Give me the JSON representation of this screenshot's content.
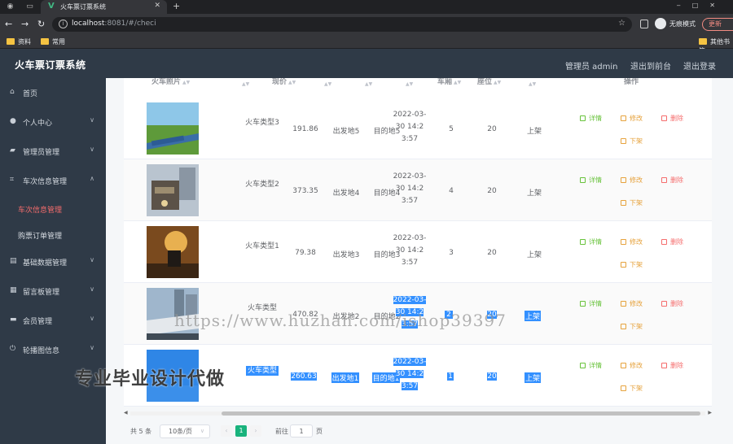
{
  "browser": {
    "tab_title": "火车票订票系统",
    "url_host": "localhost",
    "url_rest": ":8081/#/checi",
    "incognito_label": "无痕模式",
    "update_label": "更新",
    "bookmarks": [
      "资料",
      "常用",
      "其他书签"
    ]
  },
  "header": {
    "title": "火车票订票系统",
    "user": "管理员 admin",
    "back_to_front": "退出到前台",
    "logout": "退出登录"
  },
  "sidebar": {
    "items": [
      {
        "label": "首页",
        "icon": "home-icon"
      },
      {
        "label": "个人中心",
        "icon": "user-icon"
      },
      {
        "label": "管理员管理",
        "icon": "folder-icon"
      },
      {
        "label": "车次信息管理",
        "icon": "crop-icon"
      },
      {
        "label": "基础数据管理",
        "icon": "list-icon"
      },
      {
        "label": "留言板管理",
        "icon": "doc-icon"
      },
      {
        "label": "会员管理",
        "icon": "chat-icon"
      },
      {
        "label": "轮播图信息",
        "icon": "power-icon"
      }
    ],
    "subitems": [
      {
        "label": "车次信息管理",
        "active": true
      },
      {
        "label": "购票订单管理",
        "active": false
      }
    ]
  },
  "table": {
    "headers": {
      "photo": "火车照片",
      "price": "现价",
      "carriage": "车厢",
      "seat": "座位",
      "actions": "操作"
    },
    "rows": [
      {
        "type": "火车类型3",
        "price": "191.86",
        "from": "出发地5",
        "to": "目的地5",
        "date": "2022-03-30 14:23:57",
        "carriage": "5",
        "seats": "20",
        "status": "上架"
      },
      {
        "type": "火车类型2",
        "price": "373.35",
        "from": "出发地4",
        "to": "目的地4",
        "date": "2022-03-30 14:23:57",
        "carriage": "4",
        "seats": "20",
        "status": "上架"
      },
      {
        "type": "火车类型1",
        "price": "79.38",
        "from": "出发地3",
        "to": "目的地3",
        "date": "2022-03-30 14:23:57",
        "carriage": "3",
        "seats": "20",
        "status": "上架"
      },
      {
        "type": "火车类型",
        "price": "470.82",
        "from": "出发地2",
        "to": "目的地2",
        "date": "2022-03-30 14:23:57",
        "carriage": "2",
        "seats": "20",
        "status": "上架"
      },
      {
        "type": "火车类型",
        "price": "260.63",
        "from": "出发地1",
        "to": "目的地1",
        "date": "2022-03-30 14:23:57",
        "carriage": "1",
        "seats": "20",
        "status": "上架"
      }
    ],
    "actions": {
      "detail": "详情",
      "edit": "修改",
      "delete": "删除",
      "offshelf": "下架"
    }
  },
  "pagination": {
    "total": "共 5 条",
    "page_size": "10条/页",
    "current_page": "1",
    "goto_label": "前往",
    "goto_value": "1",
    "page_unit": "页"
  },
  "watermark": {
    "url": "https://www.huzhan.com/ishop39397",
    "text": "专业毕业设计代做"
  },
  "colors": {
    "header_bg": "#2f3a47",
    "active_menu": "#f56c6c",
    "pager_active": "#19b37d",
    "selection": "#3390ff"
  }
}
